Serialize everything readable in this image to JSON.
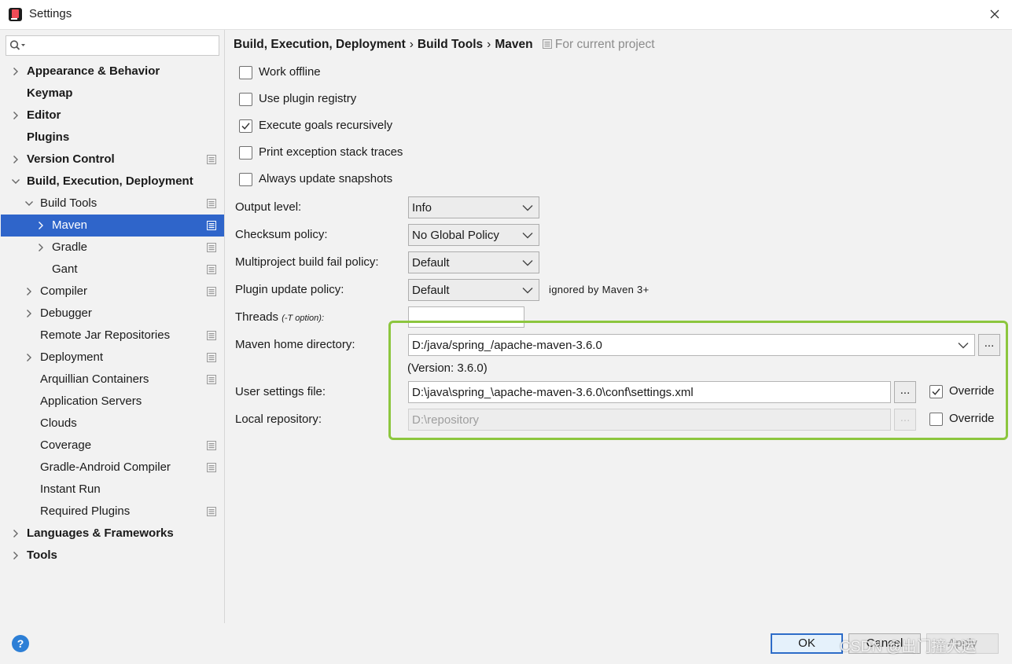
{
  "window": {
    "title": "Settings"
  },
  "search": {
    "placeholder": ""
  },
  "sidebar": {
    "items": [
      {
        "label": "Appearance & Behavior",
        "bold": true,
        "expandable": true,
        "project": false
      },
      {
        "label": "Keymap",
        "bold": true,
        "expandable": false,
        "project": false
      },
      {
        "label": "Editor",
        "bold": true,
        "expandable": true,
        "project": false
      },
      {
        "label": "Plugins",
        "bold": true,
        "expandable": false,
        "project": false
      },
      {
        "label": "Version Control",
        "bold": true,
        "expandable": true,
        "project": true
      },
      {
        "label": "Build, Execution, Deployment",
        "bold": true,
        "expandable": true,
        "expanded": true,
        "project": false
      },
      {
        "label": "Build Tools",
        "expandable": true,
        "expanded": true,
        "project": true
      },
      {
        "label": "Maven",
        "expandable": true,
        "project": true,
        "selected": true
      },
      {
        "label": "Gradle",
        "expandable": true,
        "project": true
      },
      {
        "label": "Gant",
        "expandable": false,
        "project": true
      },
      {
        "label": "Compiler",
        "expandable": true,
        "project": true
      },
      {
        "label": "Debugger",
        "expandable": true,
        "project": false
      },
      {
        "label": "Remote Jar Repositories",
        "expandable": false,
        "project": true
      },
      {
        "label": "Deployment",
        "expandable": true,
        "project": true
      },
      {
        "label": "Arquillian Containers",
        "expandable": false,
        "project": true
      },
      {
        "label": "Application Servers",
        "expandable": false,
        "project": false
      },
      {
        "label": "Clouds",
        "expandable": false,
        "project": false
      },
      {
        "label": "Coverage",
        "expandable": false,
        "project": true
      },
      {
        "label": "Gradle-Android Compiler",
        "expandable": false,
        "project": true
      },
      {
        "label": "Instant Run",
        "expandable": false,
        "project": false
      },
      {
        "label": "Required Plugins",
        "expandable": false,
        "project": true
      },
      {
        "label": "Languages & Frameworks",
        "bold": true,
        "expandable": true,
        "project": false
      },
      {
        "label": "Tools",
        "bold": true,
        "expandable": true,
        "project": false
      }
    ]
  },
  "breadcrumb": {
    "parts": [
      "Build, Execution, Deployment",
      "Build Tools",
      "Maven"
    ],
    "separator": "›",
    "scope": "For current project"
  },
  "options": {
    "checkboxes": [
      {
        "label": "Work offline",
        "checked": false
      },
      {
        "label": "Use plugin registry",
        "checked": false
      },
      {
        "label": "Execute goals recursively",
        "checked": true
      },
      {
        "label": "Print exception stack traces",
        "checked": false
      },
      {
        "label": "Always update snapshots",
        "checked": false
      }
    ],
    "output_level": {
      "label": "Output level:",
      "value": "Info"
    },
    "checksum_policy": {
      "label": "Checksum policy:",
      "value": "No Global Policy"
    },
    "multiproject_fail_policy": {
      "label": "Multiproject build fail policy:",
      "value": "Default"
    },
    "plugin_update_policy": {
      "label": "Plugin update policy:",
      "value": "Default",
      "note": "ignored by Maven 3+"
    },
    "threads": {
      "label": "Threads",
      "hint": "(-T option):",
      "value": ""
    },
    "maven_home": {
      "label": "Maven home directory:",
      "value": "D:/java/spring_/apache-maven-3.6.0",
      "version": "(Version: 3.6.0)",
      "browse": "..."
    },
    "user_settings": {
      "label": "User settings file:",
      "value": "D:\\java\\spring_\\apache-maven-3.6.0\\conf\\settings.xml",
      "browse": "...",
      "override_label": "Override",
      "override": true
    },
    "local_repository": {
      "label": "Local repository:",
      "value": "D:\\repository",
      "browse": "...",
      "override_label": "Override",
      "override": false
    }
  },
  "highlight_color": "#8cc63e",
  "accent_color": "#2f65ca",
  "buttons": {
    "help": "?",
    "ok": "OK",
    "cancel": "Cancel",
    "apply": "Apply"
  },
  "watermark": "CSDN @出门撞大运"
}
